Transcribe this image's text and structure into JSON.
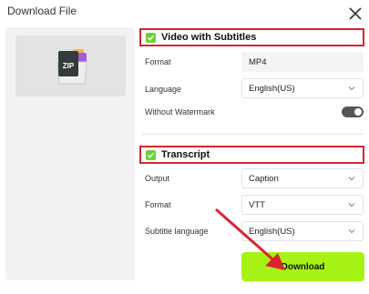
{
  "dialog": {
    "title": "Download File"
  },
  "left": {
    "file_type": "ZIP"
  },
  "video_section": {
    "label": "Video with Subtitles",
    "format_label": "Format",
    "format_value": "MP4",
    "language_label": "Language",
    "language_value": "English(US)",
    "watermark_label": "Without Watermark"
  },
  "transcript_section": {
    "label": "Transcript",
    "output_label": "Output",
    "output_value": "Caption",
    "format_label": "Format",
    "format_value": "VTT",
    "subtitle_language_label": "Subtitle language",
    "subtitle_language_value": "English(US)"
  },
  "download_label": "Download",
  "colors": {
    "accent_green": "#a7f215",
    "checkbox_green": "#6ad13a",
    "highlight_red": "#d9252f",
    "toggle_on": "#555555"
  },
  "icons": [
    "close-icon",
    "zip-file-icon",
    "check-icon",
    "chevron-down-icon"
  ]
}
